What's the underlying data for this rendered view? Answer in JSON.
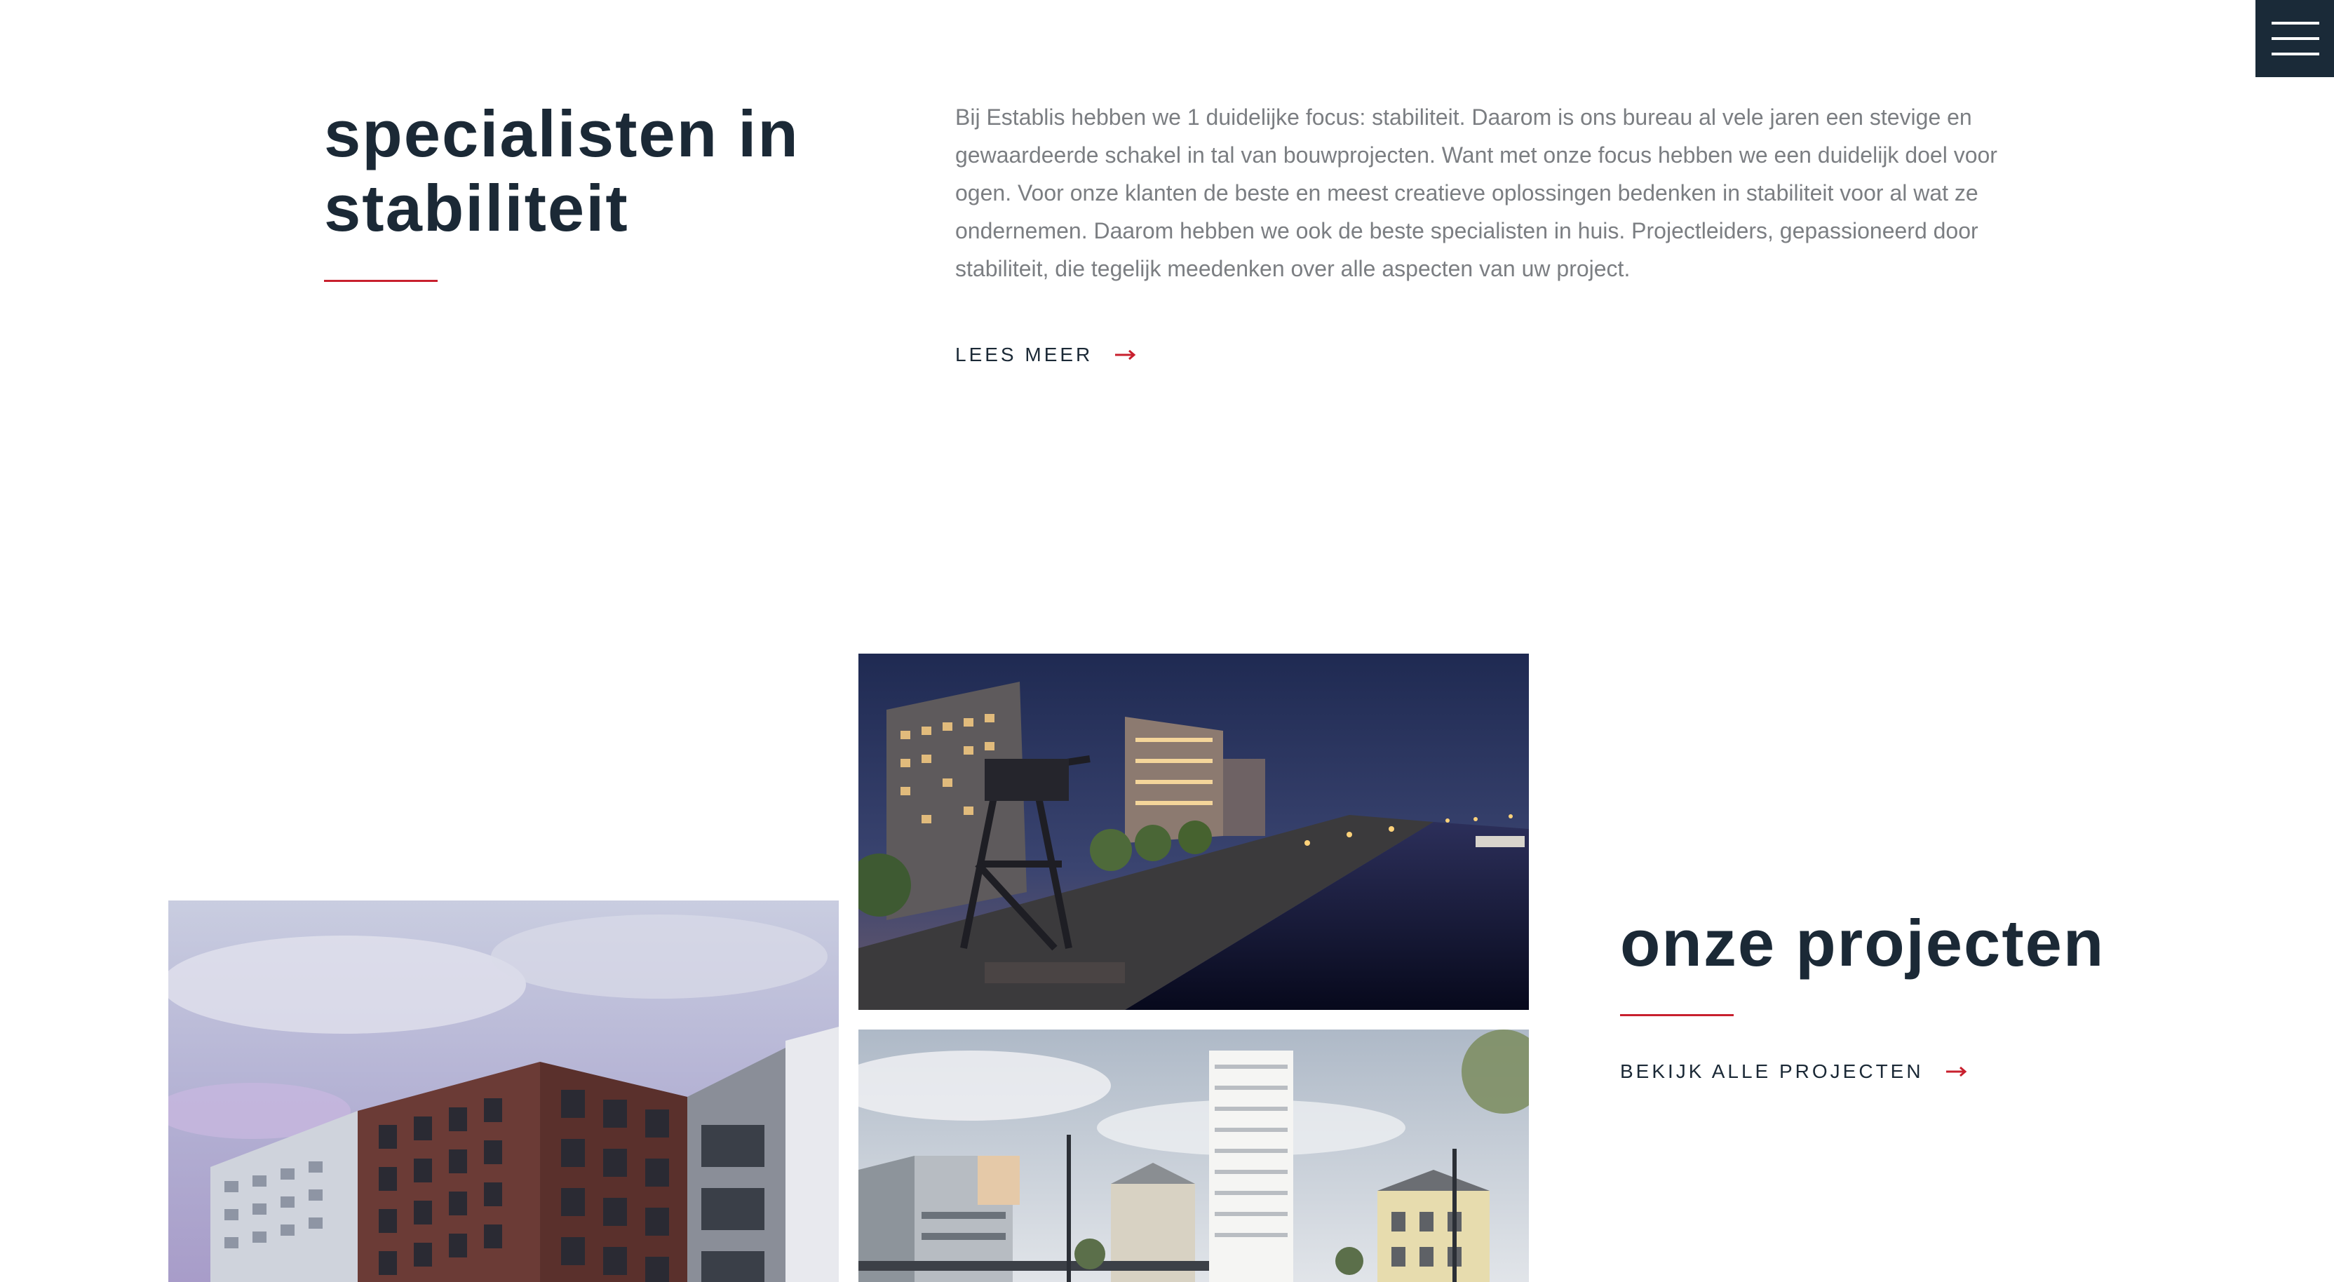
{
  "menu": {
    "icon": "hamburger-menu-icon"
  },
  "intro": {
    "title_line1": "specialisten in",
    "title_line2": "stabiliteit",
    "paragraph": "Bij Establis hebben we 1 duidelijke focus: stabiliteit. Daarom is ons bureau al vele jaren een stevige en gewaardeerde schakel in tal van bouwprojecten. Want met onze focus hebben we een duidelijk doel voor ogen. Voor onze klanten de beste en meest creatieve oplossingen bedenken in stabiliteit voor al wat ze ondernemen. Daarom hebben we ook de beste specialisten in huis. Projectleiders, gepassioneerd door stabiliteit, die tegelijk meedenken over alle aspecten van uw project.",
    "cta_label": "LEES MEER",
    "cta_icon": "arrow-right-icon"
  },
  "projects": {
    "title": "onze projecten",
    "cta_label": "BEKIJK ALLE PROJECTEN",
    "cta_icon": "arrow-right-icon",
    "images": [
      {
        "name": "brick-apartment-building-render"
      },
      {
        "name": "riverside-night-crane-render"
      },
      {
        "name": "station-square-tower-render"
      }
    ]
  },
  "colors": {
    "navy": "#1b2936",
    "accent_red": "#c8202e",
    "body_text": "#7b7e82",
    "menu_bg": "#1a2a38"
  }
}
